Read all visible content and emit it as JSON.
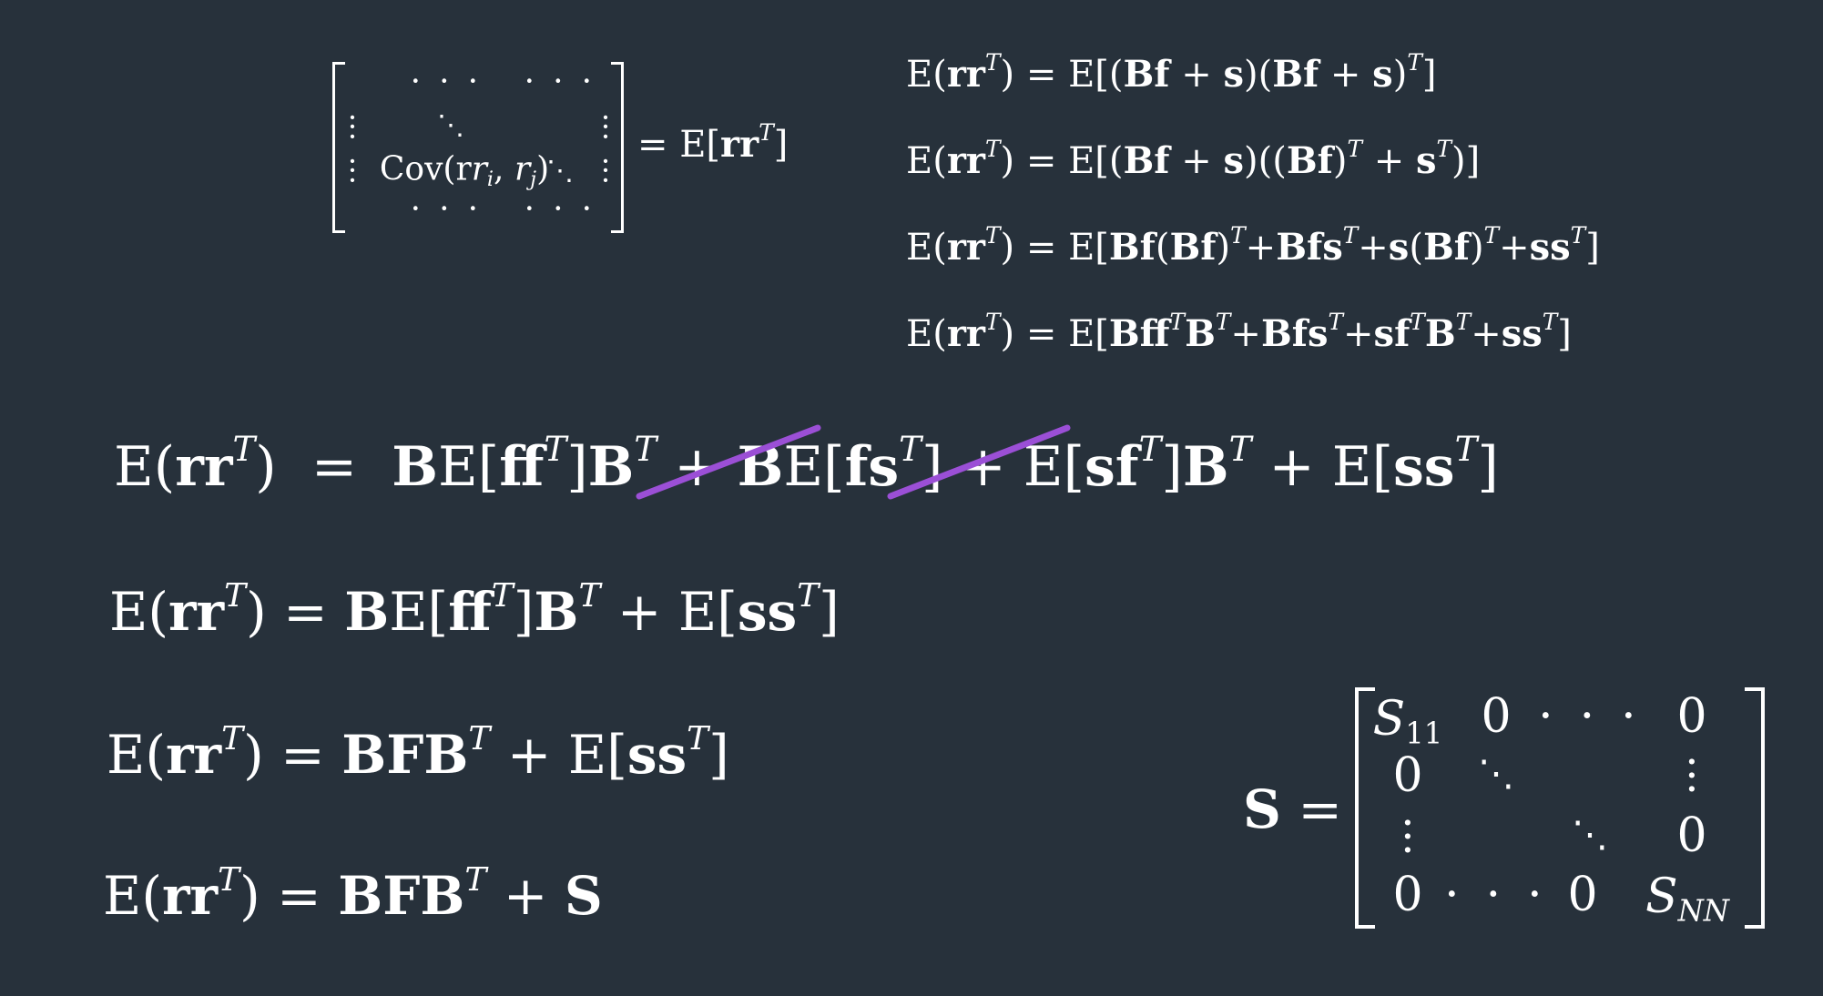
{
  "equations": {
    "rhs_top": "= E[rr",
    "cov_cell": "Cov(r",
    "top1": "E(rr^T) = E[(Bf + s)(Bf + s)^T]",
    "top2": "E(rr^T) = E[(Bf + s)((Bf)^T + s^T)]",
    "top3": "E(rr^T) = E[Bf(Bf)^T+Bfs^T+s(Bf)^T+ss^T]",
    "top4": "E(rr^T) = E[Bff^TB^T+Bfs^T+sf^TB^T+ss^T]",
    "main1": "E(rr^T) = BE[ff^T]B^T + BE[fs^T] + E[sf^T]B^T + E[ss^T]",
    "main2": "E(rr^T) = BE[ff^T]B^T + E[ss^T]",
    "main3": "E(rr^T) = BFB^T + E[ss^T]",
    "main4": "E(rr^T) = BFB^T + S",
    "s_def": "S ="
  },
  "matrix_s": {
    "s11": "S",
    "s11_sub": "11",
    "snn": "S",
    "snn_sub": "NN",
    "zero": "0"
  },
  "colors": {
    "background": "#27313b",
    "text": "#ffffff",
    "strike": "#9b4fd6"
  }
}
